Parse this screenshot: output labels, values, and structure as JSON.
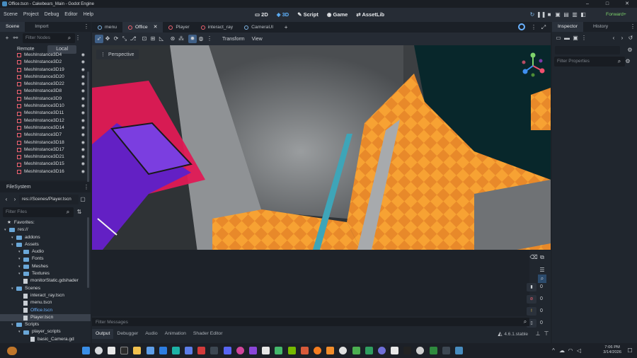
{
  "window": {
    "title": "Office.tscn - Cakebears_Main - Godot Engine"
  },
  "menubar": {
    "menus": [
      "Scene",
      "Project",
      "Debug",
      "Editor",
      "Help"
    ],
    "workspaces": [
      "2D",
      "3D",
      "Script",
      "Game",
      "AssetLib"
    ],
    "active_workspace": "3D",
    "renderer": "Forward+"
  },
  "scene_panel": {
    "tabs": [
      "Scene",
      "Import"
    ],
    "filter_placeholder": "Filter Nodes",
    "remote_label": "Remote",
    "local_label": "Local",
    "nodes": [
      "MeshInstance3D4",
      "MeshInstance3D2",
      "MeshInstance3D19",
      "MeshInstance3D20",
      "MeshInstance3D22",
      "MeshInstance3D8",
      "MeshInstance3D9",
      "MeshInstance3D10",
      "MeshInstance3D11",
      "MeshInstance3D12",
      "MeshInstance3D14",
      "MeshInstance3D7",
      "MeshInstance3D18",
      "MeshInstance3D17",
      "MeshInstance3D21",
      "MeshInstance3D15",
      "MeshInstance3D16",
      "MeshInstance3D5"
    ]
  },
  "filesystem": {
    "title": "FileSystem",
    "path": "res://Scenes/Player.tscn",
    "filter_placeholder": "Filter Files",
    "favorites": "Favorites:",
    "items": [
      {
        "label": "res://",
        "kind": "folder",
        "indent": 0
      },
      {
        "label": "addons",
        "kind": "folder",
        "indent": 1
      },
      {
        "label": "Assets",
        "kind": "folder",
        "indent": 1
      },
      {
        "label": "Audio",
        "kind": "folder",
        "indent": 2
      },
      {
        "label": "Fonts",
        "kind": "folder",
        "indent": 2
      },
      {
        "label": "Meshes",
        "kind": "folder",
        "indent": 2
      },
      {
        "label": "Textures",
        "kind": "folder",
        "indent": 2
      },
      {
        "label": "monitorStatic.gdshader",
        "kind": "file",
        "indent": 2
      },
      {
        "label": "Scenes",
        "kind": "folder",
        "indent": 1
      },
      {
        "label": "interact_ray.tscn",
        "kind": "file",
        "indent": 2
      },
      {
        "label": "menu.tscn",
        "kind": "file",
        "indent": 2
      },
      {
        "label": "Office.tscn",
        "kind": "file-open",
        "indent": 2
      },
      {
        "label": "Player.tscn",
        "kind": "file-selected",
        "indent": 2
      },
      {
        "label": "Scripts",
        "kind": "folder",
        "indent": 1
      },
      {
        "label": "player_scripts",
        "kind": "folder",
        "indent": 2
      },
      {
        "label": "basic_Camera.gd",
        "kind": "file",
        "indent": 3
      }
    ]
  },
  "doc_tabs": [
    "menu",
    "Office",
    "Player",
    "interact_ray",
    "CameraUI"
  ],
  "active_doc": "Office",
  "viewport": {
    "perspective_label": "Perspective",
    "toolbar_menus": [
      "Transform",
      "View"
    ]
  },
  "bottom": {
    "filter_placeholder": "Filter Messages",
    "tabs": [
      "Output",
      "Debugger",
      "Audio",
      "Animation",
      "Shader Editor"
    ],
    "active_tab": "Output",
    "version": "4.6.1.stable",
    "counters": [
      "0",
      "0",
      "0",
      "0"
    ]
  },
  "inspector": {
    "tabs": [
      "Inspector",
      "History"
    ],
    "filter_placeholder": "Filter Properties"
  },
  "taskbar": {
    "time": "7:06 PM",
    "date": "3/14/2026"
  },
  "colors": {
    "accent": "#5fb4ff",
    "node_icon": "#f06270",
    "floor": "#f39a2c",
    "wall": "#8d9093",
    "trim": "#e02a55",
    "screen": "#6d2bd6"
  }
}
